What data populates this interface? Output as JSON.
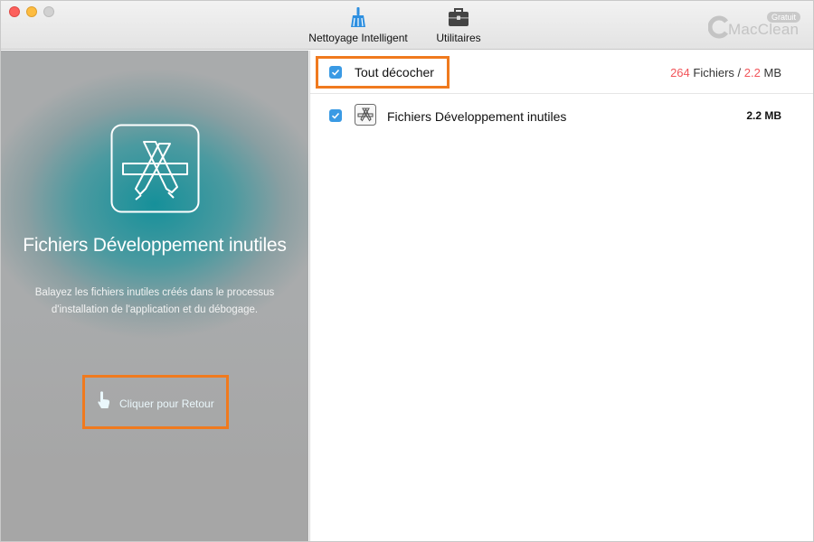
{
  "toolbar": {
    "tools": [
      {
        "label": "Nettoyage Intelligent",
        "icon": "broom-icon",
        "active": true
      },
      {
        "label": "Utilitaires",
        "icon": "toolbox-icon",
        "active": false
      }
    ],
    "brand": {
      "name": "MacClean",
      "badge": "Gratuit"
    }
  },
  "left_panel": {
    "icon": "app-store-icon",
    "title": "Fichiers Développement inutiles",
    "description_line1": "Balayez les fichiers inutiles créés dans le processus",
    "description_line2": "d'installation de l'application et du débogage.",
    "back_label": "Cliquer pour Retour"
  },
  "right_panel": {
    "select_all": {
      "label": "Tout décocher",
      "checked": true
    },
    "summary": {
      "count": "264",
      "files_word": "Fichiers",
      "separator": "/",
      "size": "2.2",
      "unit": "MB"
    },
    "items": [
      {
        "label": "Fichiers Développement inutiles",
        "size": "2.2 MB",
        "checked": true,
        "icon": "app-store-icon"
      }
    ]
  },
  "colors": {
    "accent": "#3a9ae4",
    "highlight": "#f07a1e",
    "count_red": "#f2555a"
  }
}
